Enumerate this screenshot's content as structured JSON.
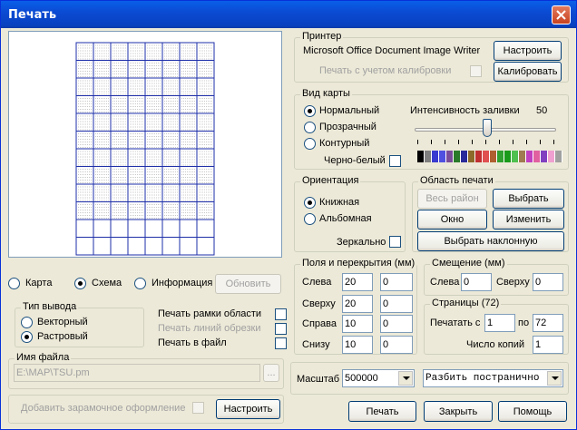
{
  "window": {
    "title": "Печать"
  },
  "printer": {
    "group_title": "Принтер",
    "name": "Microsoft Office Document Image Writer",
    "calibrate_print_label": "Печать с учетом калибровки",
    "setup_button": "Настроить",
    "calibrate_button": "Калибровать"
  },
  "map_view": {
    "group_title": "Вид карты",
    "options": [
      "Нормальный",
      "Прозрачный",
      "Контурный"
    ],
    "selected": "Нормальный",
    "fill_intensity_label": "Интенсивность заливки",
    "fill_intensity_value": "50",
    "fill_intensity_level": 50,
    "bw_label": "Черно-белый",
    "palette": [
      "#000000",
      "#7f7f7f",
      "#3a3ad0",
      "#5050e0",
      "#7a4c9a",
      "#2a7a2a",
      "#2a2a9a",
      "#8c6a2a",
      "#c03030",
      "#e05050",
      "#b06030",
      "#30a030",
      "#1a9a1a",
      "#50c050",
      "#a07a50",
      "#c040c0",
      "#e060a0",
      "#8040c0",
      "#f0a0d0",
      "#a0a0a0"
    ]
  },
  "orientation": {
    "group_title": "Ориентация",
    "options": [
      "Книжная",
      "Альбомная"
    ],
    "selected": "Книжная",
    "mirror_label": "Зеркально"
  },
  "print_area": {
    "group_title": "Область печати",
    "whole_area": "Весь район",
    "select": "Выбрать",
    "window": "Окно",
    "change": "Изменить",
    "select_tilted": "Выбрать наклонную"
  },
  "mode": {
    "options": [
      "Карта",
      "Схема",
      "Информация"
    ],
    "selected": "Схема",
    "refresh_button": "Обновить"
  },
  "output_type": {
    "group_title": "Тип вывода",
    "options": [
      "Векторный",
      "Растровый"
    ],
    "selected": "Растровый"
  },
  "print_flags": {
    "frame_label": "Печать рамки области",
    "cut_lines_label": "Печать линий обрезки",
    "to_file_label": "Печать в файл"
  },
  "file": {
    "group_title": "Имя файла",
    "path": "E:\\MAP\\TSU.pm",
    "browse_label": "..."
  },
  "frame_design": {
    "label": "Добавить зарамочное оформление",
    "setup_button": "Настроить"
  },
  "margins": {
    "group_title": "Поля и перекрытия (мм)",
    "rows": [
      {
        "label": "Слева",
        "field": "20",
        "overlap": "0"
      },
      {
        "label": "Сверху",
        "field": "20",
        "overlap": "0"
      },
      {
        "label": "Справа",
        "field": "10",
        "overlap": "0"
      },
      {
        "label": "Снизу",
        "field": "10",
        "overlap": "0"
      }
    ]
  },
  "offset": {
    "group_title": "Смещение (мм)",
    "left_label": "Слева",
    "left_value": "0",
    "top_label": "Сверху",
    "top_value": "0"
  },
  "pages": {
    "group_title": "Страницы (72)",
    "print_from_label": "Печатать с",
    "from_value": "1",
    "to_label": "по",
    "to_value": "72",
    "copies_label": "Число копий",
    "copies_value": "1"
  },
  "scale": {
    "label": "Масштаб",
    "value": "500000",
    "split_mode": "Разбить постранично"
  },
  "footer": {
    "print_button": "Печать",
    "close_button": "Закрыть",
    "help_button": "Помощь"
  }
}
